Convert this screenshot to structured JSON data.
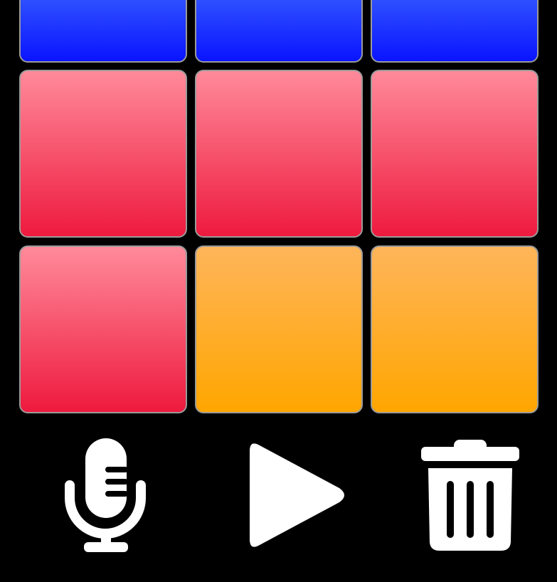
{
  "pad_grid": {
    "rows": [
      [
        "blue",
        "blue",
        "blue"
      ],
      [
        "red",
        "red",
        "red"
      ],
      [
        "red",
        "orange",
        "orange"
      ]
    ]
  },
  "colors": {
    "background": "#000000",
    "blue": "#1a2cff",
    "red": "#f0344f",
    "orange": "#ffad2a",
    "pad_border": "#9a9a9a",
    "icon": "#ffffff"
  },
  "controls": {
    "record_icon": "microphone-icon",
    "play_icon": "play-icon",
    "delete_icon": "trash-icon"
  }
}
